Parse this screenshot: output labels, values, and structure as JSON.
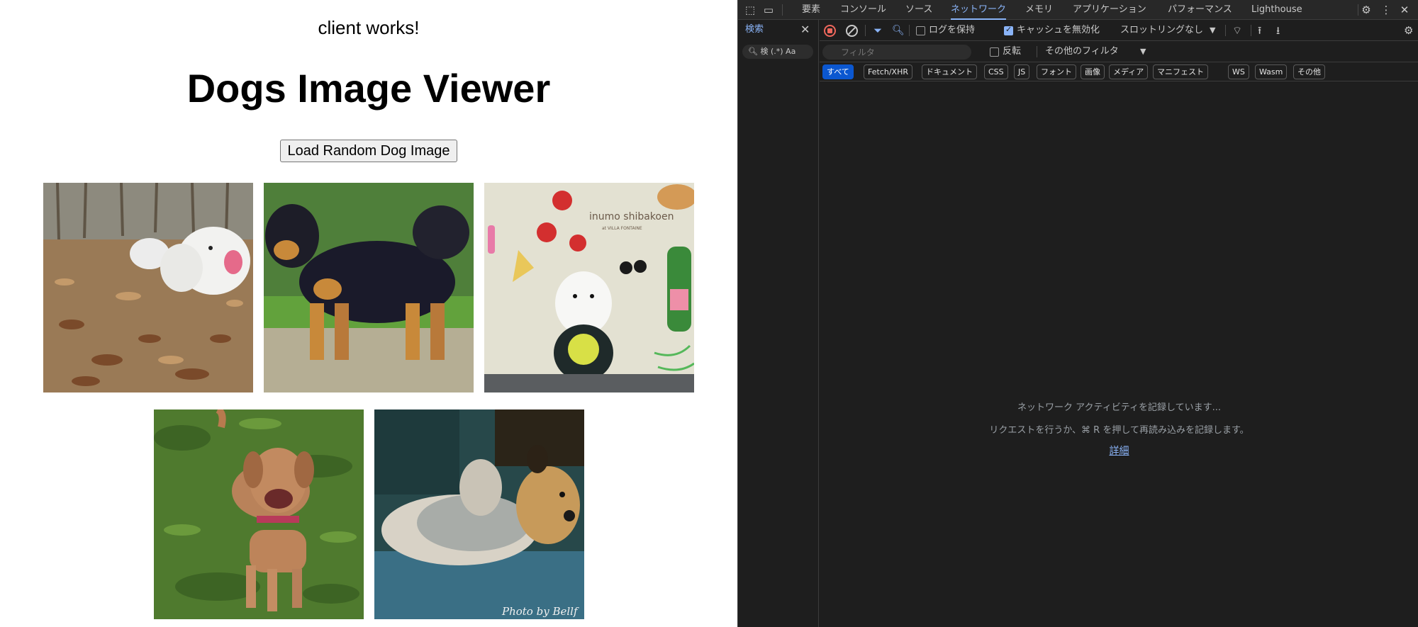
{
  "page": {
    "heading_small": "client works!",
    "title": "Dogs Image Viewer",
    "load_button": "Load Random Dog Image",
    "images": [
      {
        "name": "dog-image-1",
        "photo_credit": ""
      },
      {
        "name": "dog-image-2",
        "photo_credit": ""
      },
      {
        "name": "dog-image-3",
        "sign_text": "inumo shibakoen",
        "sign_subtext": "at VILLA FONTAINE"
      },
      {
        "name": "dog-image-4",
        "photo_credit": ""
      },
      {
        "name": "dog-image-5",
        "photo_credit": "Photo by Bellf"
      }
    ]
  },
  "devtools": {
    "tabs": [
      {
        "label": "要素",
        "active": false
      },
      {
        "label": "コンソール",
        "active": false
      },
      {
        "label": "ソース",
        "active": false
      },
      {
        "label": "ネットワーク",
        "active": true
      },
      {
        "label": "メモリ",
        "active": false
      },
      {
        "label": "アプリケーション",
        "active": false
      },
      {
        "label": "パフォーマンス",
        "active": false
      },
      {
        "label": "Lighthouse",
        "active": false
      }
    ],
    "search_panel": {
      "tab_label": "検索",
      "box_text": "検 (.*) Aa"
    },
    "toolbar": {
      "preserve_log": "ログを保持",
      "preserve_log_checked": false,
      "disable_cache": "キャッシュを無効化",
      "disable_cache_checked": true,
      "throttling": "スロットリングなし"
    },
    "filter": {
      "placeholder": "フィルタ",
      "invert": "反転",
      "invert_checked": false,
      "more_filters": "その他のフィルタ"
    },
    "type_filters": [
      "すべて",
      "Fetch/XHR",
      "ドキュメント",
      "CSS",
      "JS",
      "フォント",
      "画像",
      "メディア",
      "マニフェスト",
      "WS",
      "Wasm",
      "その他"
    ],
    "active_type": "すべて",
    "empty_state": {
      "line1": "ネットワーク アクティビティを記録しています...",
      "line2": "リクエストを行うか、⌘ R を押して再読み込みを記録します。",
      "link": "詳細"
    },
    "colors": {
      "background": "#1e1e1e",
      "accent": "#8ab4f8",
      "record": "#ee675c",
      "active_chip": "#0b57d0"
    }
  }
}
